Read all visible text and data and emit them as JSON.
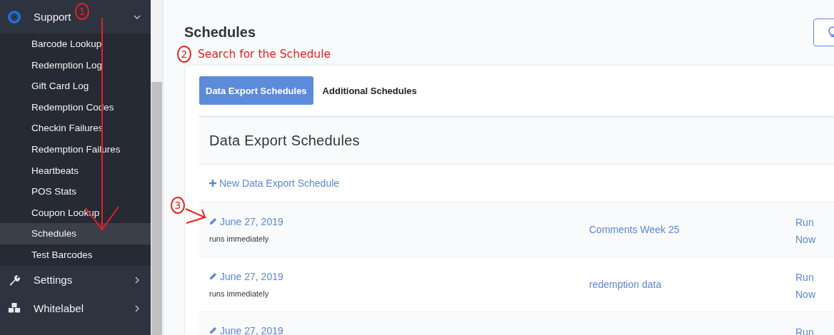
{
  "sidebar": {
    "items": [
      {
        "label": "Support",
        "expanded": true,
        "children": [
          {
            "label": "Barcode Lookup",
            "selected": false
          },
          {
            "label": "Redemption Log",
            "selected": false
          },
          {
            "label": "Gift Card Log",
            "selected": false
          },
          {
            "label": "Redemption Codes",
            "selected": false
          },
          {
            "label": "Checkin Failures",
            "selected": false
          },
          {
            "label": "Redemption Failures",
            "selected": false
          },
          {
            "label": "Heartbeats",
            "selected": false
          },
          {
            "label": "POS Stats",
            "selected": false
          },
          {
            "label": "Coupon Lookup",
            "selected": false
          },
          {
            "label": "Schedules",
            "selected": true
          },
          {
            "label": "Test Barcodes",
            "selected": false
          }
        ]
      },
      {
        "label": "Settings",
        "expanded": false
      },
      {
        "label": "Whitelabel",
        "expanded": false
      }
    ]
  },
  "page": {
    "title": "Schedules"
  },
  "annotations": {
    "step_1": "1",
    "step_2": "2",
    "note": "Search for the Schedule",
    "step_3": "3"
  },
  "tabs": [
    {
      "label": "Data Export Schedules",
      "selected": true
    },
    {
      "label": "Additional Schedules",
      "selected": false
    }
  ],
  "section": {
    "title": "Data Export Schedules",
    "new_link": "New Data Export Schedule"
  },
  "rows": [
    {
      "date": "June 27, 2019",
      "note": "runs immediately",
      "name": "Comments Week 25",
      "action": "Run Now"
    },
    {
      "date": "June 27, 2019",
      "note": "runs immediately",
      "name": "redemption data",
      "action": "Run Now"
    },
    {
      "date": "June 27, 2019",
      "action": "Run"
    }
  ]
}
